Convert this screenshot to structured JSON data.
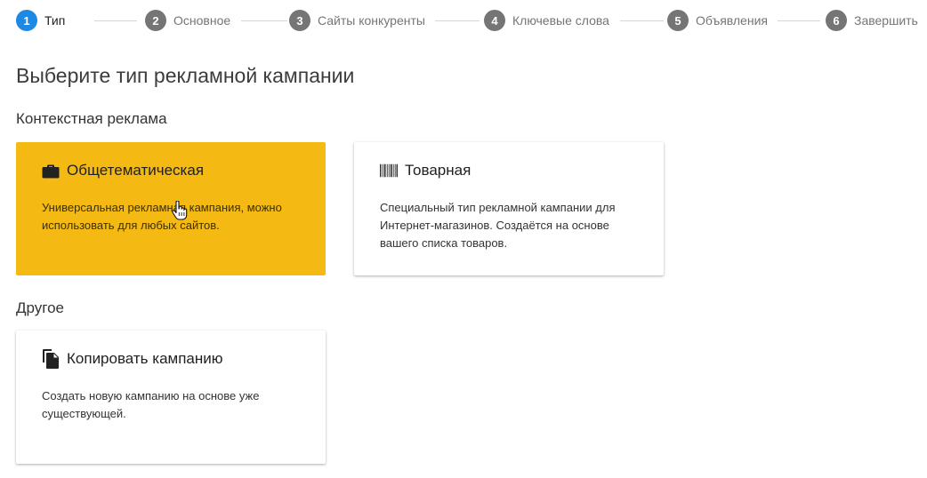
{
  "stepper": {
    "steps": [
      {
        "num": "1",
        "label": "Тип",
        "active": true
      },
      {
        "num": "2",
        "label": "Основное"
      },
      {
        "num": "3",
        "label": "Сайты конкуренты"
      },
      {
        "num": "4",
        "label": "Ключевые слова"
      },
      {
        "num": "5",
        "label": "Объявления"
      },
      {
        "num": "6",
        "label": "Завершить"
      }
    ],
    "active_color": "#1e88e5",
    "inactive_color": "#757575"
  },
  "page": {
    "title": "Выберите тип рекламной кампании"
  },
  "sections": {
    "contextual": {
      "title": "Контекстная реклама",
      "cards": {
        "general": {
          "icon": "briefcase-icon",
          "title": "Общетематическая",
          "description": "Универсальная рекламная кампания, можно использовать для любых сайтов.",
          "selected": true,
          "color": "#f4b913"
        },
        "products": {
          "icon": "barcode-icon",
          "title": "Товарная",
          "description": "Специальный тип рекламной кампании для Интернет-магазинов. Создаётся на основе вашего списка товаров."
        }
      }
    },
    "other": {
      "title": "Другое",
      "cards": {
        "copy": {
          "icon": "copy-file-icon",
          "title": "Копировать кампанию",
          "description": "Создать новую кампанию на основе уже существующей."
        }
      }
    }
  }
}
